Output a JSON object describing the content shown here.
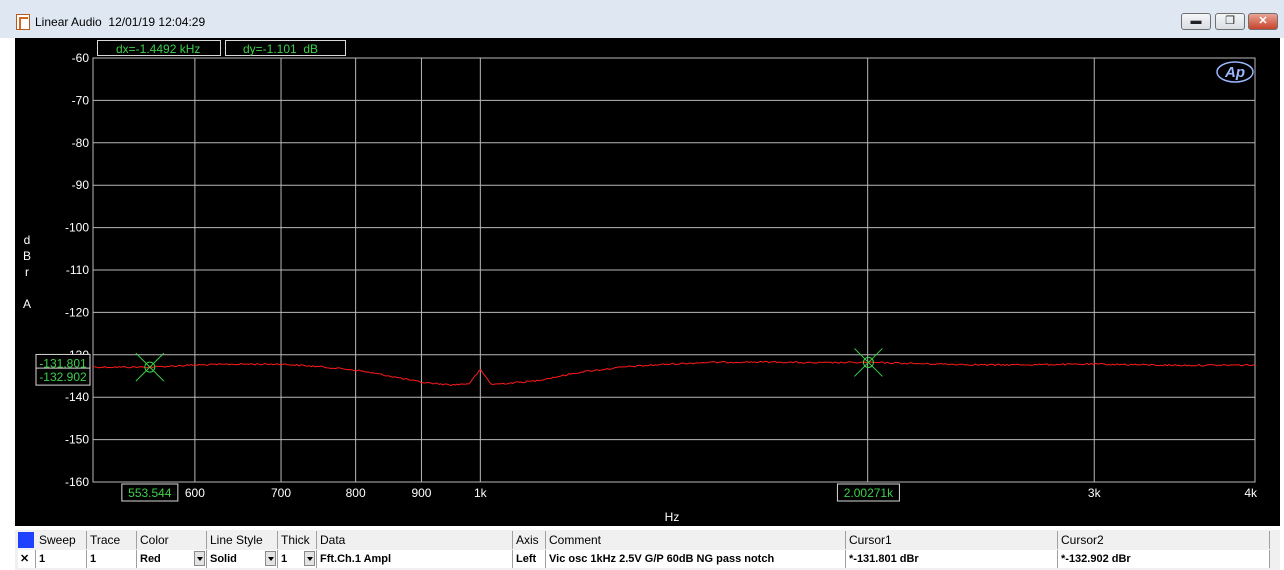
{
  "window": {
    "title": "Linear Audio  12/01/19 12:04:29",
    "controls": {
      "minimize": "▬",
      "restore": "❐",
      "close": "✕"
    }
  },
  "readouts": {
    "dx": "dx=-1.4492 kHz",
    "dy": "dy=-1.101  dB"
  },
  "plot": {
    "y_axis_label": [
      "d",
      "B",
      "r",
      "",
      "A"
    ],
    "x_axis_label": "Hz",
    "y_ticks": [
      "-60",
      "-70",
      "-80",
      "-90",
      "-100",
      "-110",
      "-120",
      "-130",
      "-140",
      "-150",
      "-160"
    ],
    "x_ticks": [
      "600",
      "700",
      "800",
      "900",
      "1k",
      "3k",
      "4k"
    ],
    "cursor1": {
      "y_label": "-131.801",
      "x_label": "2.00271k"
    },
    "cursor2": {
      "y_label": "-132.902",
      "x_label": "553.544"
    },
    "colors": {
      "background": "#000000",
      "grid": "#b8b8b8",
      "trace": "#ff1a1a",
      "cursor": "#3cd04a",
      "tick_text": "#ffffff"
    },
    "logo": "Ap"
  },
  "chart_data": {
    "type": "line",
    "title": "",
    "xlabel": "Hz",
    "ylabel": "dBr A",
    "x_scale": "log",
    "xlim": [
      500,
      4000
    ],
    "ylim": [
      -160,
      -60
    ],
    "grid": true,
    "series": [
      {
        "name": "Fft.Ch.1 Ampl",
        "x": [
          500,
          553.5,
          600,
          650,
          700,
          750,
          800,
          850,
          900,
          950,
          980,
          1000,
          1020,
          1100,
          1200,
          1300,
          1400,
          1500,
          1600,
          1700,
          1800,
          2002.7,
          2200,
          2500,
          3000,
          3500,
          4000
        ],
        "y": [
          -132.9,
          -132.9,
          -132.4,
          -132.2,
          -132.2,
          -132.8,
          -133.6,
          -135.0,
          -136.5,
          -137.1,
          -136.8,
          -133.5,
          -137.0,
          -136.2,
          -134.0,
          -132.8,
          -132.2,
          -131.8,
          -131.7,
          -131.7,
          -131.9,
          -131.8,
          -132.1,
          -132.4,
          -132.2,
          -132.5,
          -132.4
        ]
      }
    ],
    "cursors": [
      {
        "name": "Cursor1",
        "x": 2002.71,
        "y": -131.801
      },
      {
        "name": "Cursor2",
        "x": 553.544,
        "y": -132.902
      }
    ]
  },
  "table": {
    "headers": {
      "sweep": "Sweep",
      "trace": "Trace",
      "color": "Color",
      "line_style": "Line Style",
      "thick": "Thick",
      "data": "Data",
      "axis": "Axis",
      "comment": "Comment",
      "cursor1": "Cursor1",
      "cursor2": "Cursor2"
    },
    "row": {
      "checked": "✕",
      "sweep": "1",
      "trace": "1",
      "color": "Red",
      "line_style": "Solid",
      "thick": "1",
      "data": "Fft.Ch.1 Ampl",
      "axis": "Left",
      "comment": "Vic osc 1kHz 2.5V G/P 60dB NG pass notch",
      "cursor1": "*-131.801 dBr",
      "cursor2": "*-132.902 dBr"
    }
  }
}
